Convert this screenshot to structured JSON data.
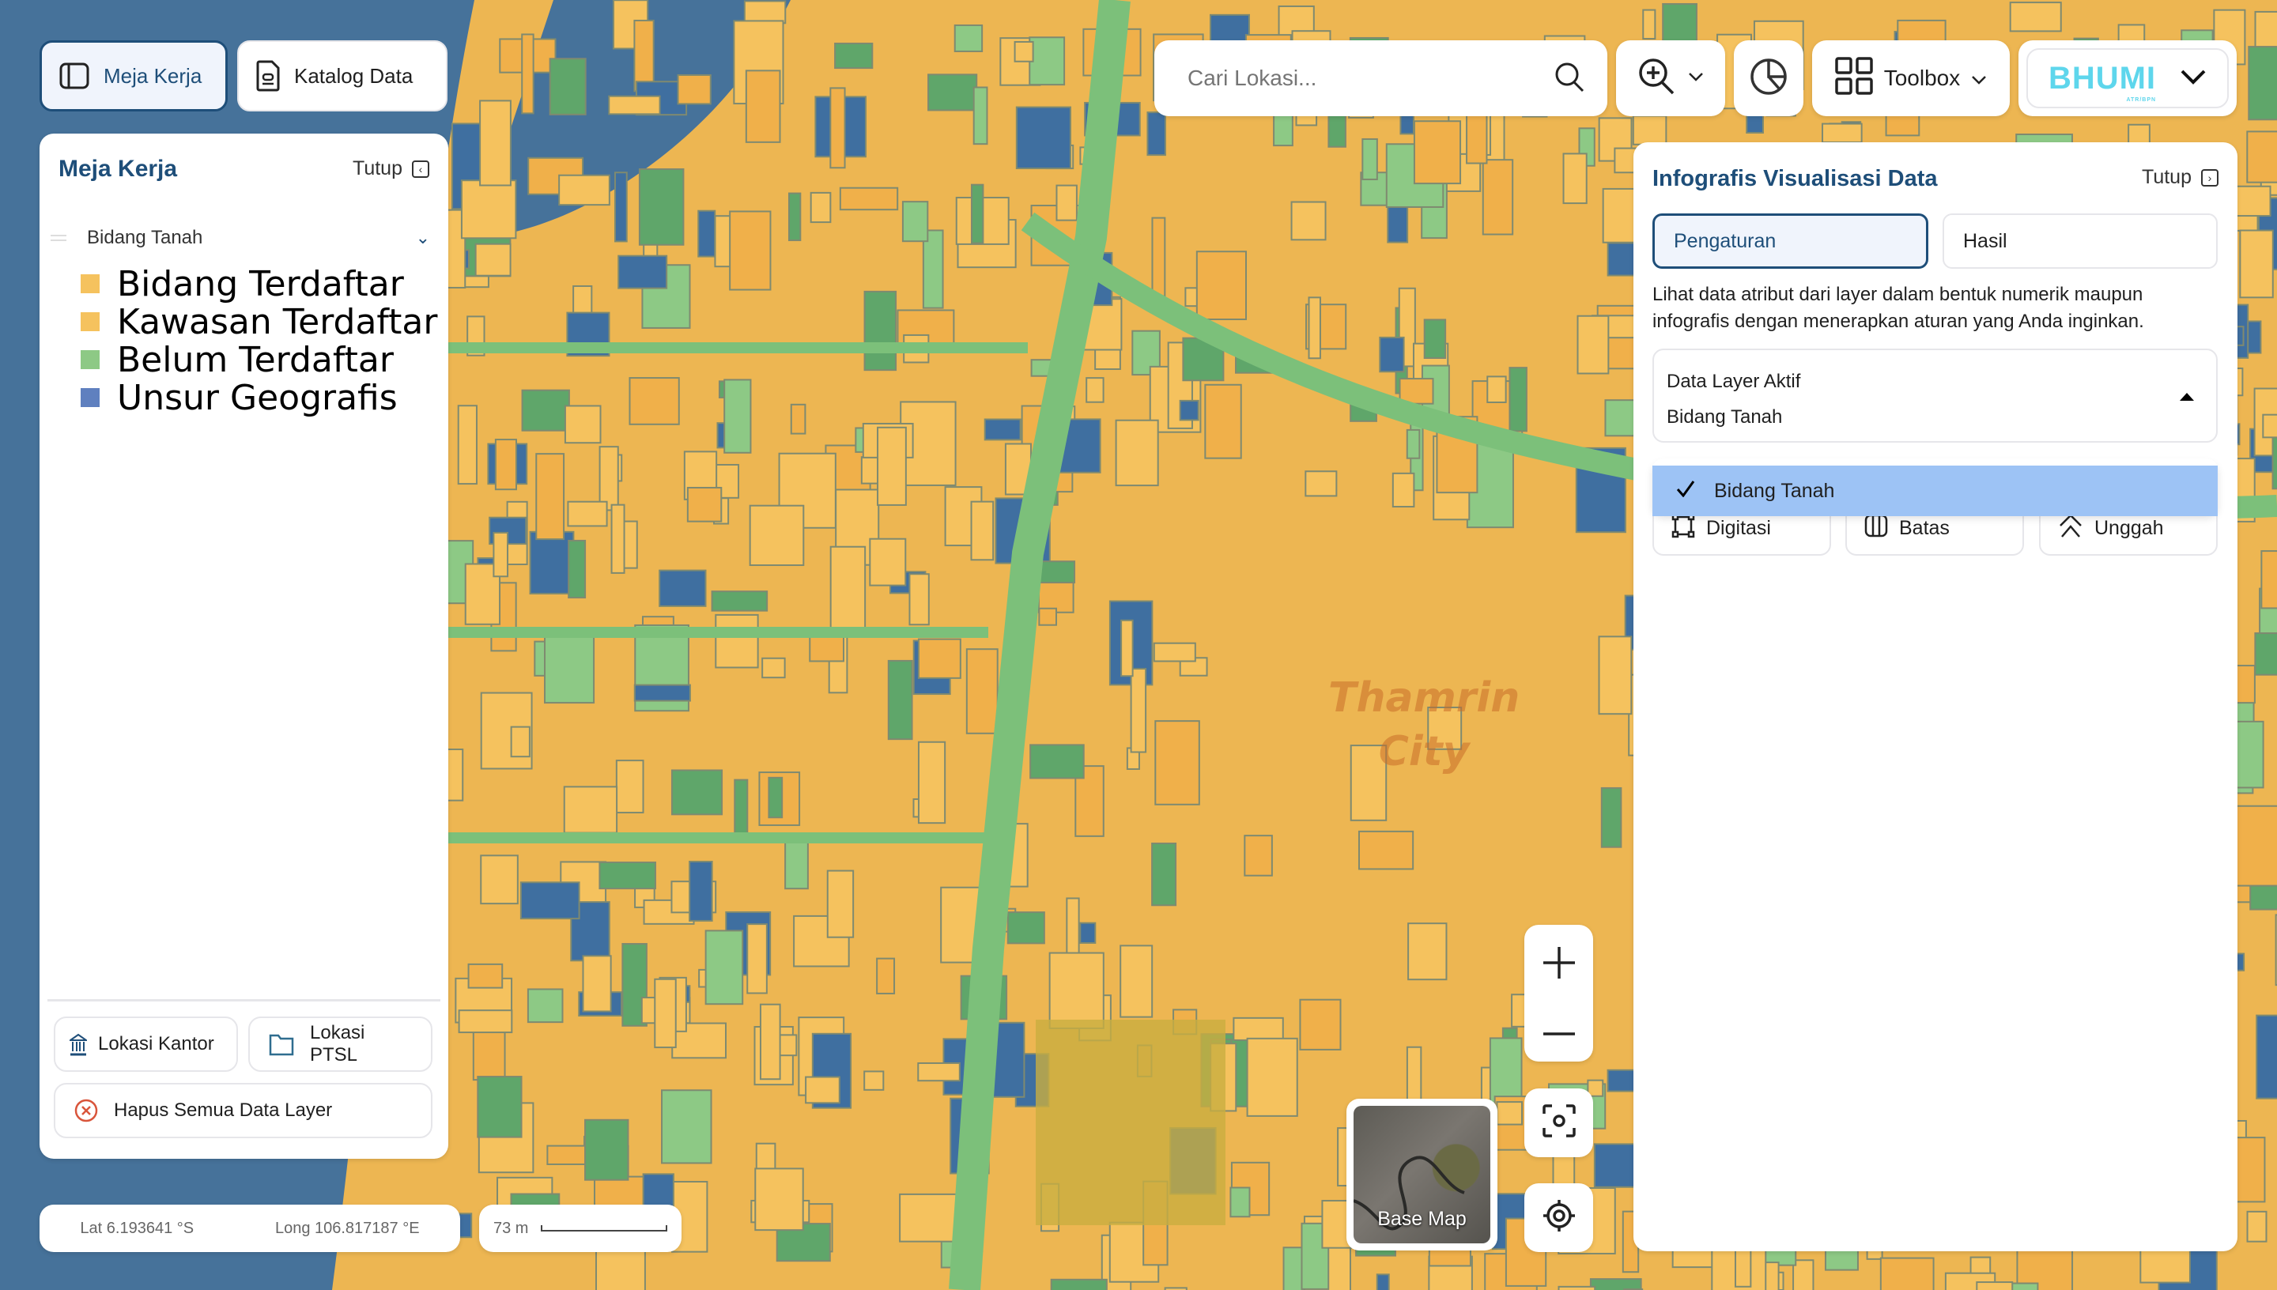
{
  "colors": {
    "bidang_terdaftar": "#F5C25E",
    "kawasan_terdaftar": "#F5C25E",
    "belum_terdaftar": "#8DC985",
    "unsur_geografis": "#5F80BF",
    "accent": "#1E4E79",
    "bhumi": "#5ED6EC",
    "danger": "#D9553B",
    "selected_option": "#9DC3F5"
  },
  "top_tabs": {
    "meja_kerja": "Meja Kerja",
    "katalog_data": "Katalog Data"
  },
  "left_panel": {
    "title": "Meja Kerja",
    "close_label": "Tutup",
    "layer": {
      "name": "Bidang Tanah",
      "legend": [
        {
          "label": "Bidang Terdaftar",
          "color": "#F5C25E"
        },
        {
          "label": "Kawasan Terdaftar",
          "color": "#F5C25E"
        },
        {
          "label": "Belum Terdaftar",
          "color": "#8DC985"
        },
        {
          "label": "Unsur Geografis",
          "color": "#5F80BF"
        }
      ]
    },
    "buttons": {
      "lokasi_kantor": "Lokasi Kantor",
      "lokasi_ptsl": "Lokasi PTSL",
      "hapus": "Hapus Semua Data Layer"
    }
  },
  "coords": {
    "lat": "Lat 6.193641 °S",
    "long": "Long 106.817187 °E",
    "scale": "73 m"
  },
  "toolbar": {
    "search_placeholder": "Cari Lokasi...",
    "toolbox": "Toolbox",
    "brand": "BHUMI",
    "brand_sub": "ATR/BPN"
  },
  "right_panel": {
    "title": "Infografis Visualisasi Data",
    "close_label": "Tutup",
    "tabs": [
      "Pengaturan",
      "Hasil"
    ],
    "active_tab": "Pengaturan",
    "description": "Lihat data atribut dari layer dalam bentuk numerik maupun infografis dengan menerapkan aturan yang Anda inginkan.",
    "select": {
      "label": "Data Layer Aktif",
      "value": "Bidang Tanah",
      "options": [
        {
          "label": "Bidang Tanah",
          "selected": true
        }
      ]
    },
    "tools": [
      "Digitasi",
      "Batas",
      "Unggah"
    ]
  },
  "map": {
    "labels": [
      "Thamrin\nCity"
    ],
    "base_map_label": "Base Map"
  }
}
